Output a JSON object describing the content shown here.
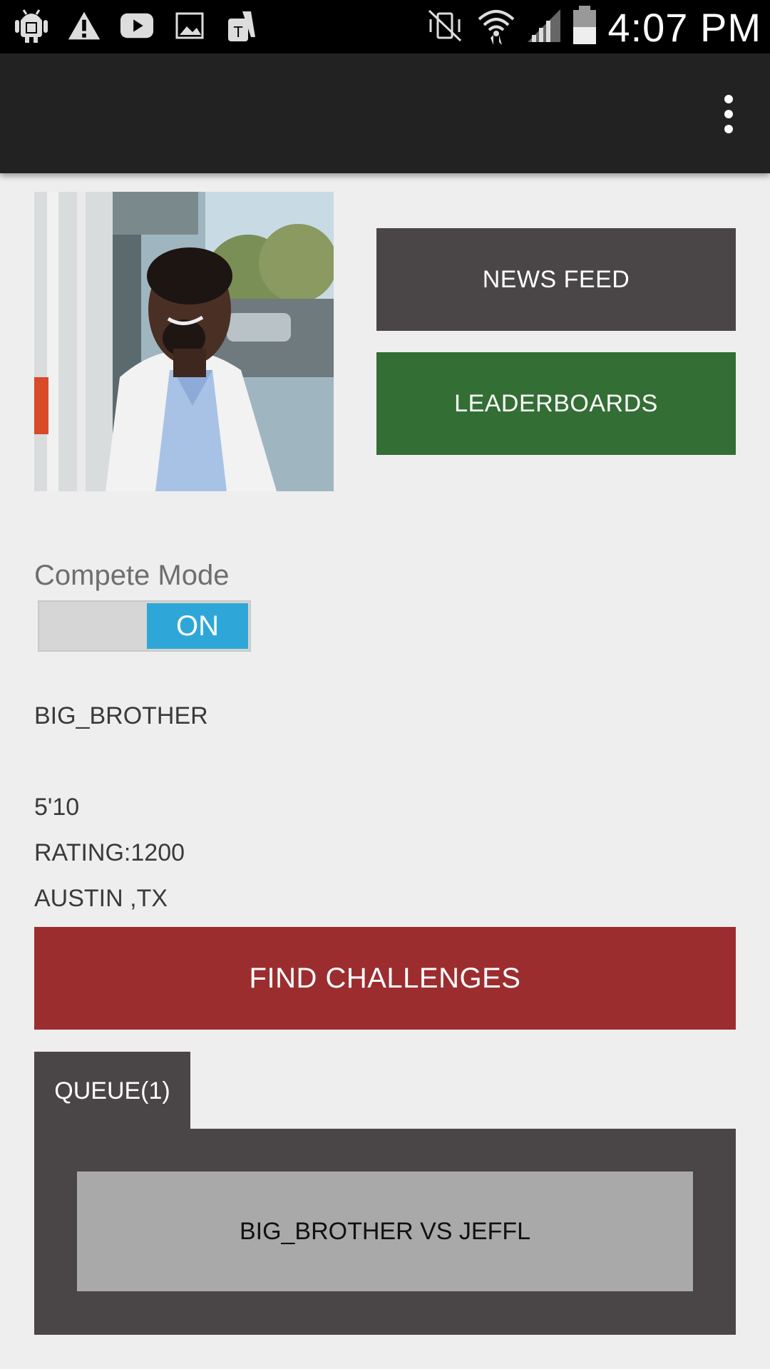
{
  "status_bar": {
    "time": "4:07 PM",
    "left_icons": [
      "android-debug-icon",
      "warning-icon",
      "youtube-icon",
      "image-icon",
      "tmobile-app-icon"
    ],
    "right_icons": [
      "vibrate-mute-icon",
      "wifi-icon",
      "signal-icon",
      "battery-icon"
    ]
  },
  "action_bar": {
    "overflow_icon": "overflow-menu-icon"
  },
  "profile": {
    "avatar_icon": "profile-photo"
  },
  "buttons": {
    "news_feed": "NEWS FEED",
    "leaderboards": "LEADERBOARDS",
    "find_challenges": "FIND CHALLENGES"
  },
  "compete": {
    "label": "Compete Mode",
    "toggle_state": "ON"
  },
  "player": {
    "username": "BIG_BROTHER",
    "height": "5'10",
    "rating": "RATING:1200",
    "location": "AUSTIN ,TX"
  },
  "queue": {
    "tab_label": "QUEUE(1)",
    "items": [
      {
        "label": "BIG_BROTHER VS JEFFL"
      }
    ]
  },
  "colors": {
    "news_feed_bg": "#4a4647",
    "leaderboards_bg": "#336e34",
    "find_challenges_bg": "#9c2d2f",
    "toggle_on": "#2ea7d8",
    "queue_bg": "#4a4647",
    "queue_item_bg": "#a9a9a9"
  }
}
